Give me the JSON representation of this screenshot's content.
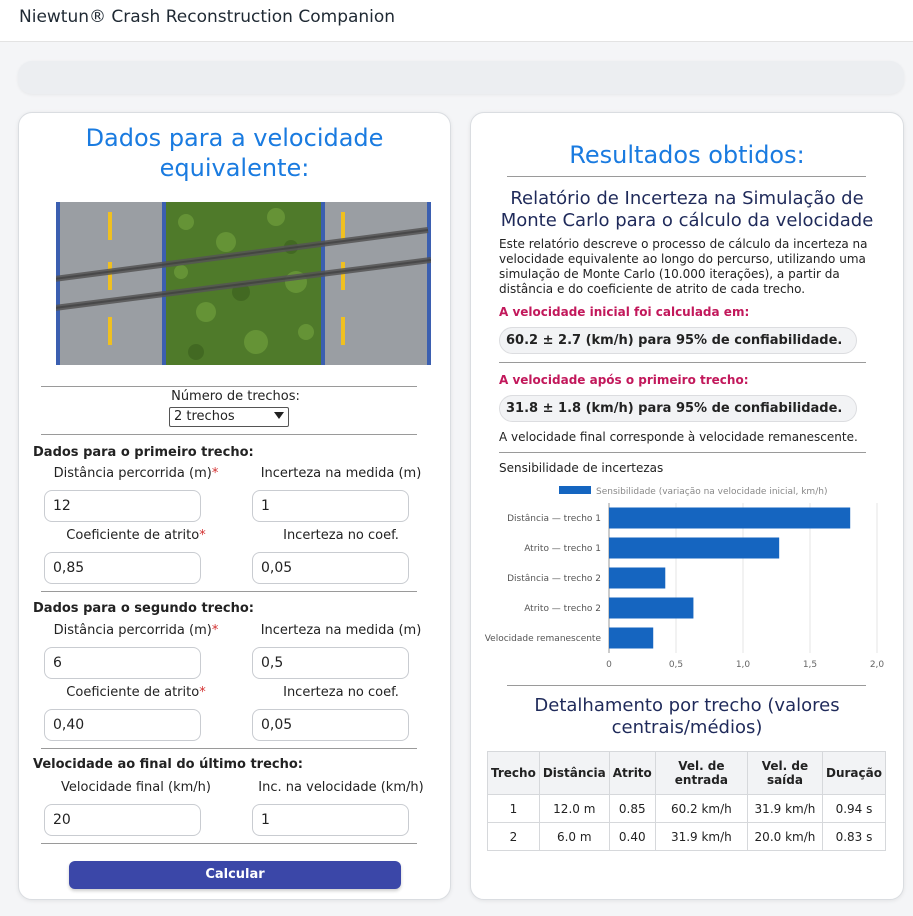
{
  "header": {
    "brand": "Niewtun® Crash Reconstruction Companion"
  },
  "left": {
    "title": "Dados para a velocidade equivalente:",
    "num_trechos_label": "Número de trechos:",
    "num_trechos_value": "2 trechos",
    "section1": {
      "title": "Dados para o primeiro trecho:",
      "dist_label": "Distância percorrida (m)",
      "dist_value": "12",
      "incert_label": "Incerteza na medida (m)",
      "incert_value": "1",
      "coef_label": "Coeficiente de atrito",
      "coef_value": "0,85",
      "incert_coef_label": "Incerteza no coef.",
      "incert_coef_value": "0,05"
    },
    "section2": {
      "title": "Dados para o segundo trecho:",
      "dist_label": "Distância percorrida (m)",
      "dist_value": "6",
      "incert_label": "Incerteza na medida (m)",
      "incert_value": "0,5",
      "coef_label": "Coeficiente de atrito",
      "coef_value": "0,40",
      "incert_coef_label": "Incerteza no coef.",
      "incert_coef_value": "0,05"
    },
    "section3": {
      "title": "Velocidade ao final do último trecho:",
      "vel_label": "Velocidade final (km/h)",
      "vel_value": "20",
      "inc_label": "Inc. na velocidade (km/h)",
      "inc_value": "1"
    },
    "required_mark": "*",
    "calc_button": "Calcular"
  },
  "right": {
    "title": "Resultados obtidos:",
    "report_title": "Relatório de Incerteza na Simulação de Monte Carlo para o cálculo da velocidade",
    "report_desc": "Este relatório descreve o processo de cálculo da incerteza na velocidade equivalente ao longo do percurso, utilizando uma simulação de Monte Carlo (10.000 iterações), a partir da distância e do coeficiente de atrito de cada trecho.",
    "initial_label": "A velocidade inicial foi calculada em:",
    "initial_value": "60.2 ± 2.7 (km/h) para 95% de confiabilidade.",
    "after_label": "A velocidade após o primeiro trecho:",
    "after_value": "31.8 ± 1.8 (km/h) para 95% de confiabilidade.",
    "final_note": "A velocidade final corresponde à velocidade remanescente.",
    "sens_title": "Sensibilidade de incertezas",
    "detail_title": "Detalhamento por trecho (valores centrais/médios)",
    "table": {
      "headers": [
        "Trecho",
        "Distância",
        "Atrito",
        "Vel. de entrada",
        "Vel. de saída",
        "Duração"
      ],
      "rows": [
        [
          "1",
          "12.0 m",
          "0.85",
          "60.2 km/h",
          "31.9 km/h",
          "0.94 s"
        ],
        [
          "2",
          "6.0 m",
          "0.40",
          "31.9 km/h",
          "20.0 km/h",
          "0.83 s"
        ]
      ]
    }
  },
  "chart_data": {
    "type": "bar",
    "orientation": "horizontal",
    "categories": [
      "Distância — trecho 1",
      "Atrito — trecho 1",
      "Distância — trecho 2",
      "Atrito — trecho 2",
      "Velocidade remanescente"
    ],
    "series": [
      {
        "name": "Sensibilidade (variação na velocidade inicial, km/h)",
        "values": [
          1.8,
          1.27,
          0.42,
          0.63,
          0.33
        ]
      }
    ],
    "xlim": [
      0,
      2.0
    ],
    "xticks": [
      "0",
      "0,5",
      "1,0",
      "1,5",
      "2,0"
    ],
    "legend": "top",
    "grid": true,
    "color": "#1565c0"
  }
}
